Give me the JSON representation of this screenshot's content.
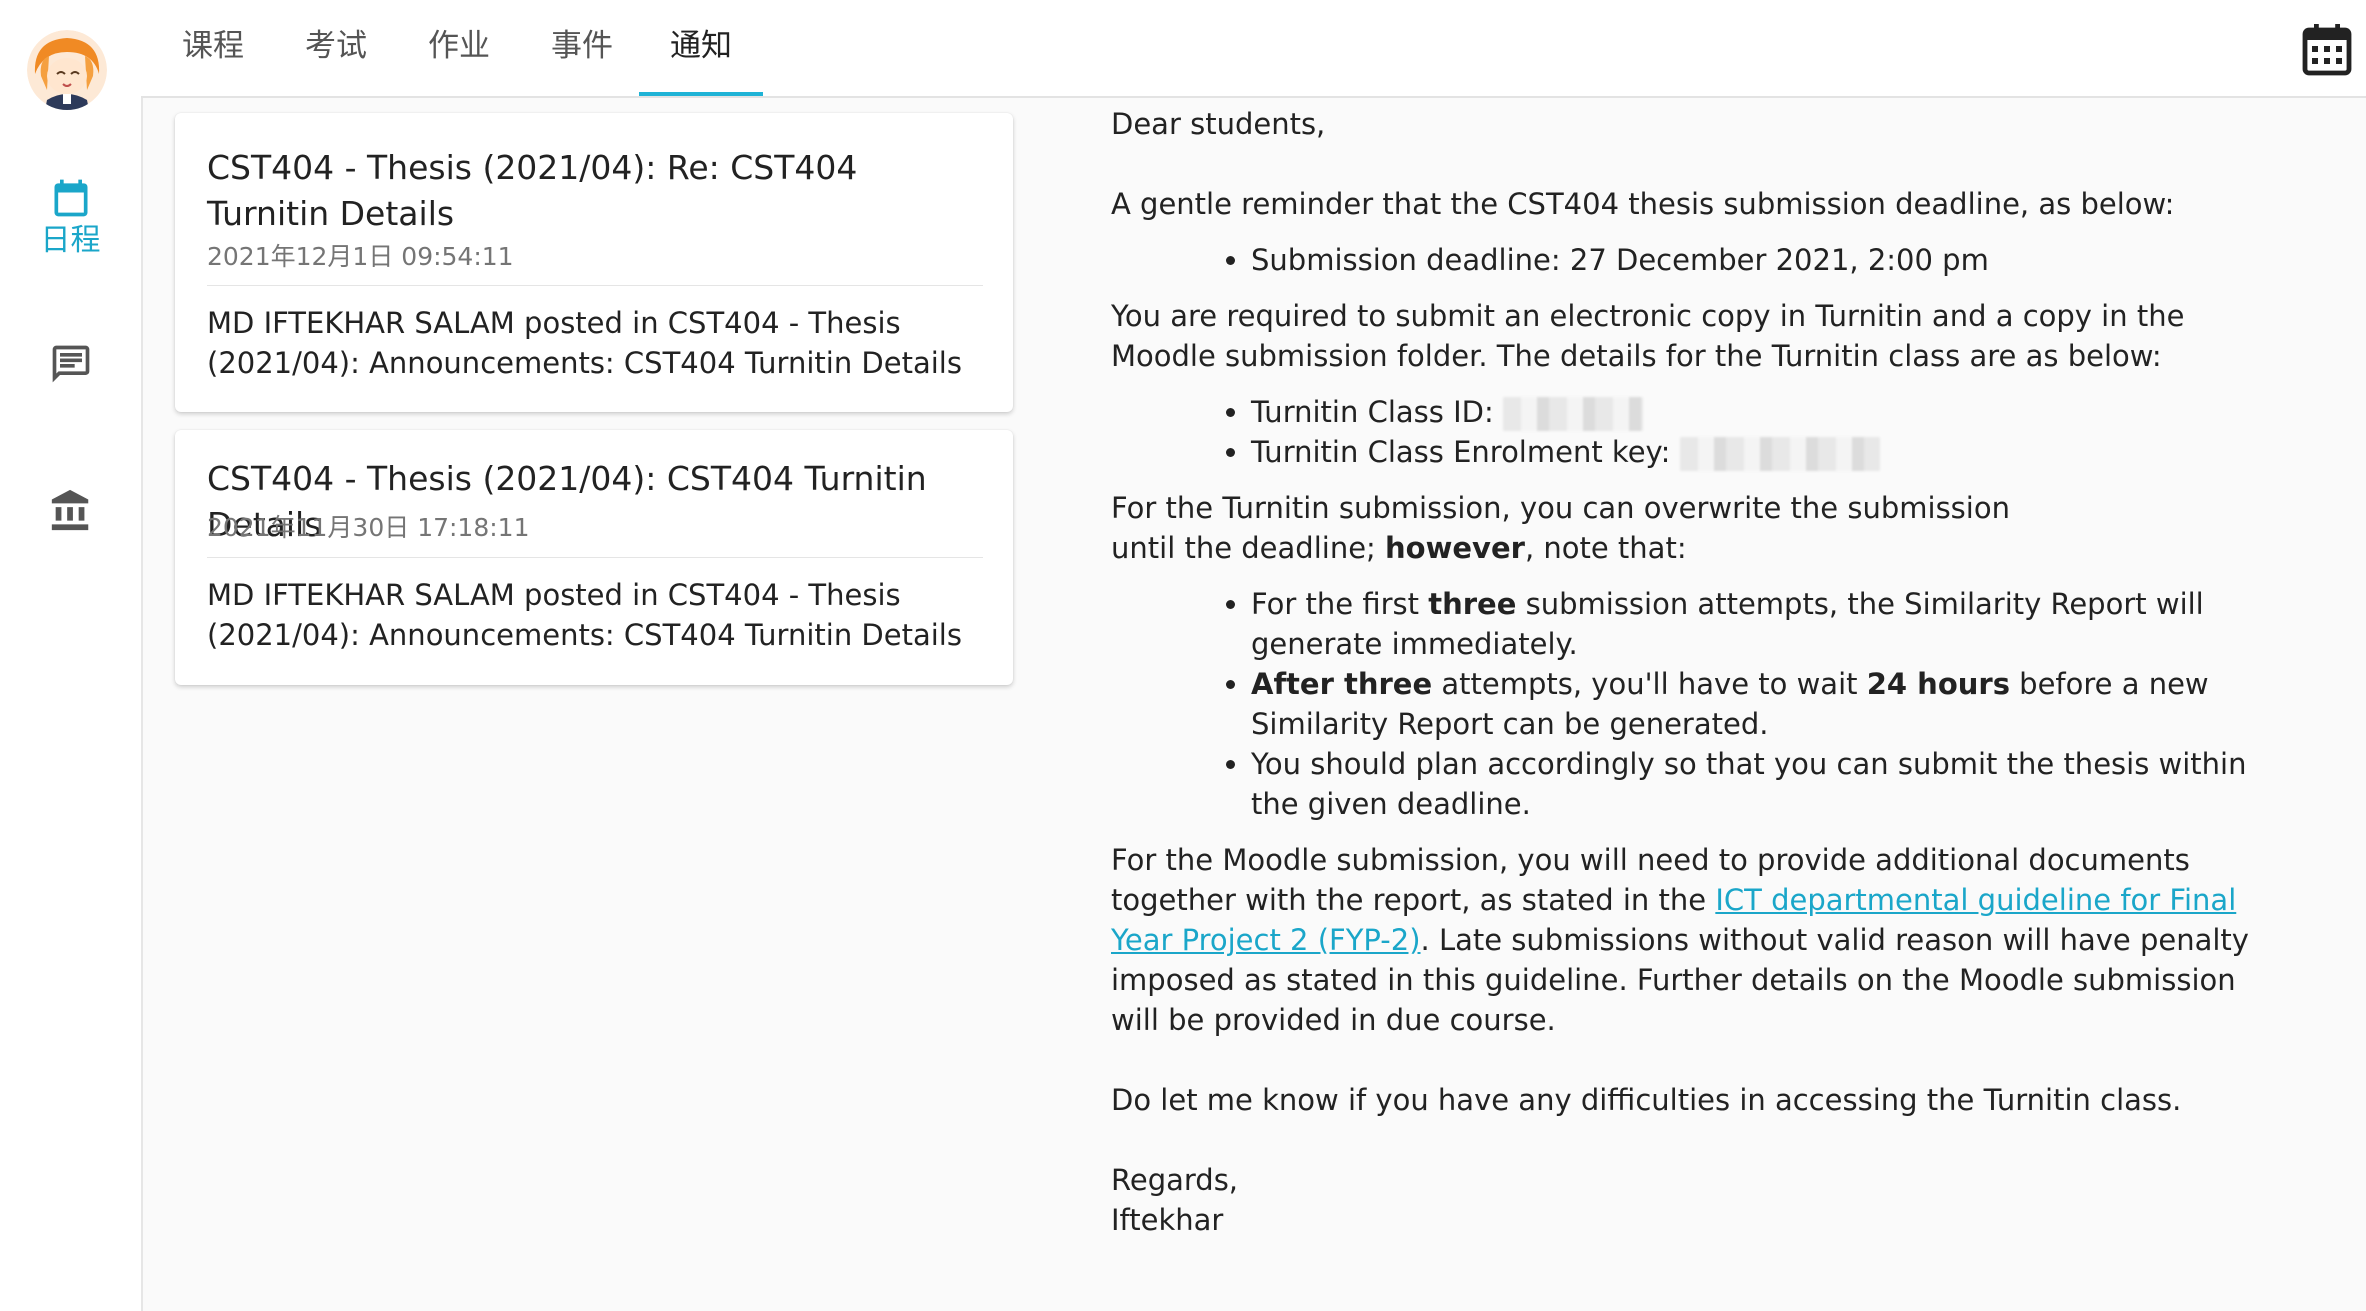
{
  "tabs": [
    {
      "label": "课程"
    },
    {
      "label": "考试"
    },
    {
      "label": "作业"
    },
    {
      "label": "事件"
    },
    {
      "label": "通知",
      "active": true
    }
  ],
  "rail": {
    "schedule_label": "日程",
    "schedule_icon": "calendar-icon",
    "messages_icon": "chat-icon",
    "institution_icon": "bank-icon",
    "accent_color": "#1aa6c9"
  },
  "notifications": [
    {
      "title": "CST404 - Thesis (2021/04): Re: CST404 Turnitin Details",
      "date": "2021年12月1日 09:54:11",
      "body": "MD IFTEKHAR SALAM posted in CST404 - Thesis (2021/04): Announcements: CST404 Turnitin Details"
    },
    {
      "title": "CST404 - Thesis (2021/04): CST404 Turnitin Details",
      "date": "2021年11月30日 17:18:11",
      "body": "MD IFTEKHAR SALAM posted in CST404 - Thesis (2021/04): Announcements: CST404 Turnitin Details"
    }
  ],
  "message": {
    "greeting": "Dear students,",
    "reminder": "A gentle reminder that the CST404 thesis submission deadline, as below:",
    "deadline_item": "Submission deadline: 27 December 2021, 2:00 pm",
    "required": "You are required to submit an electronic copy in Turnitin and a copy in the Moodle submission folder. The details for the Turnitin class are as below:",
    "class_id_label": "Turnitin Class ID:",
    "enrol_key_label": "Turnitin Class Enrolment key:",
    "overwrite_prefix": "For the Turnitin submission, you can overwrite the submission until the deadline; ",
    "overwrite_bold": "however",
    "overwrite_suffix": ", note that:",
    "b1_pre": "For the first ",
    "b1_bold": "three",
    "b1_post": " submission attempts, the Similarity Report will generate immediately.",
    "b2_bold1": "After three",
    "b2_mid": " attempts, you'll have to wait ",
    "b2_bold2": "24 hours",
    "b2_post": " before a new Similarity Report can be generated.",
    "b3": "You should plan accordingly so that you can submit the thesis within the given deadline.",
    "moodle_pre": "For the Moodle submission, you will need to provide additional documents together with the report, as stated in the ",
    "moodle_link": "ICT departmental guideline for Final Year Project 2 (FYP-2)",
    "moodle_post": ". Late submissions without valid reason will have penalty imposed as stated in this guideline. Further details on the Moodle submission will be provided in due course.",
    "difficulties": "Do let me know if you have any difficulties in accessing the Turnitin class.",
    "regards": "Regards,",
    "signature": "Iftekhar"
  }
}
